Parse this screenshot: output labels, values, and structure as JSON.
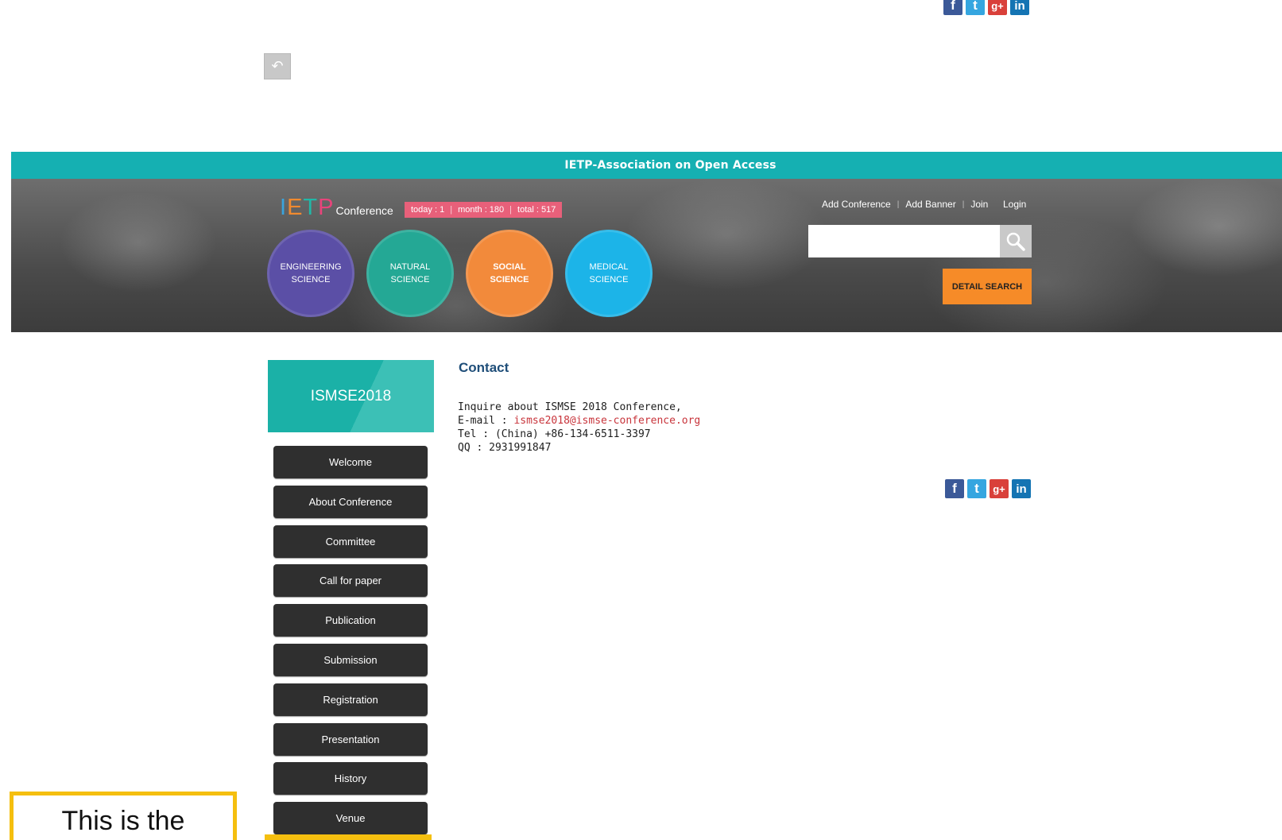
{
  "social": {
    "icons": [
      "facebook-icon",
      "twitter-icon",
      "google-plus-icon",
      "linkedin-icon"
    ],
    "labels": [
      "f",
      "t",
      "g+",
      "in"
    ]
  },
  "back_button": {
    "icon": "undo-icon",
    "glyph": "↶"
  },
  "topbar": {
    "text": "IETP-Association on Open Access"
  },
  "logo": {
    "ietp": "IETP",
    "conference": "Conference"
  },
  "stats": {
    "today": "today : 1",
    "month": "month : 180",
    "total": "total : 517"
  },
  "categories": [
    {
      "label": "ENGINEERING\nSCIENCE",
      "color": "#5b4fa6"
    },
    {
      "label": "NATURAL\nSCIENCE",
      "color": "#24a895"
    },
    {
      "label": "SOCIAL\nSCIENCE",
      "color": "#f28a3b"
    },
    {
      "label": "MEDICAL\nSCIENCE",
      "color": "#1cb4e8"
    }
  ],
  "top_links": [
    "Add Conference",
    "Add Banner",
    "Join",
    "Login"
  ],
  "search": {
    "value": "",
    "placeholder": ""
  },
  "detail_search": {
    "label": "DETAIL SEARCH"
  },
  "sidebar": {
    "title": "ISMSE2018",
    "items": [
      "Welcome",
      "About Conference",
      "Committee",
      "Call for paper",
      "Publication",
      "Submission",
      "Registration",
      "Presentation",
      "History",
      "Venue"
    ]
  },
  "contact": {
    "title": "Contact",
    "line1": "Inquire about ISMSE 2018 Conference,",
    "email_label": "E-mail : ",
    "email": "ismse2018@ismse-conference.org",
    "tel": "Tel : (China) +86-134-6511-3397",
    "qq": "QQ : 2931991847"
  },
  "annotation": {
    "text": "This is the"
  },
  "colors": {
    "teal": "#15b0b2",
    "orange": "#f68b28",
    "pink": "#e8607a",
    "dark_menu": "#2f2f2f",
    "email": "#c8343b"
  }
}
